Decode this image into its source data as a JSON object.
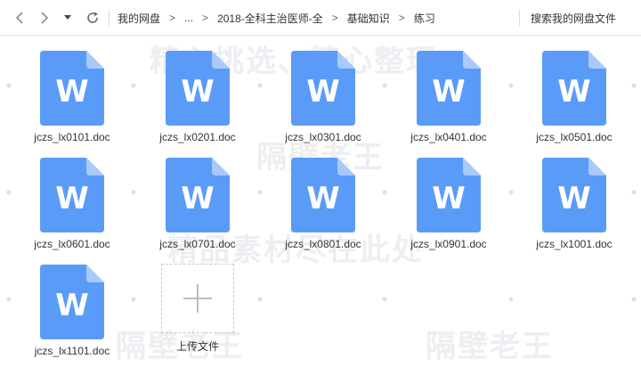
{
  "nav": {
    "back_glyph": "<",
    "forward_glyph": ">",
    "dropdown_glyph": "▼",
    "refresh_glyph": "⟳"
  },
  "breadcrumb": {
    "items": [
      "我的网盘",
      "...",
      "2018-全科主治医师-全",
      "基础知识",
      "练习"
    ],
    "separator": ">"
  },
  "search": {
    "label": "搜索我的网盘文件"
  },
  "files": [
    {
      "name": "jczs_lx0101.doc",
      "icon": "word-doc-icon",
      "letter": "W"
    },
    {
      "name": "jczs_lx0201.doc",
      "icon": "word-doc-icon",
      "letter": "W"
    },
    {
      "name": "jczs_lx0301.doc",
      "icon": "word-doc-icon",
      "letter": "W"
    },
    {
      "name": "jczs_lx0401.doc",
      "icon": "word-doc-icon",
      "letter": "W"
    },
    {
      "name": "jczs_lx0501.doc",
      "icon": "word-doc-icon",
      "letter": "W"
    },
    {
      "name": "jczs_lx0601.doc",
      "icon": "word-doc-icon",
      "letter": "W"
    },
    {
      "name": "jczs_lx0701.doc",
      "icon": "word-doc-icon",
      "letter": "W"
    },
    {
      "name": "jczs_lx0801.doc",
      "icon": "word-doc-icon",
      "letter": "W"
    },
    {
      "name": "jczs_lx0901.doc",
      "icon": "word-doc-icon",
      "letter": "W"
    },
    {
      "name": "jczs_lx1001.doc",
      "icon": "word-doc-icon",
      "letter": "W"
    },
    {
      "name": "jczs_lx1101.doc",
      "icon": "word-doc-icon",
      "letter": "W"
    }
  ],
  "upload": {
    "label": "上传文件",
    "icon": "plus-icon"
  },
  "watermarks": [
    "精心挑选、精心整理",
    "隔壁老王",
    "精品素材尽在此处",
    "隔壁老王",
    "隔壁老王"
  ],
  "colors": {
    "doc_blue": "#5b9bf8",
    "doc_fold": "#a9c9fb",
    "text": "#333333",
    "dot": "#dcdfe6"
  }
}
